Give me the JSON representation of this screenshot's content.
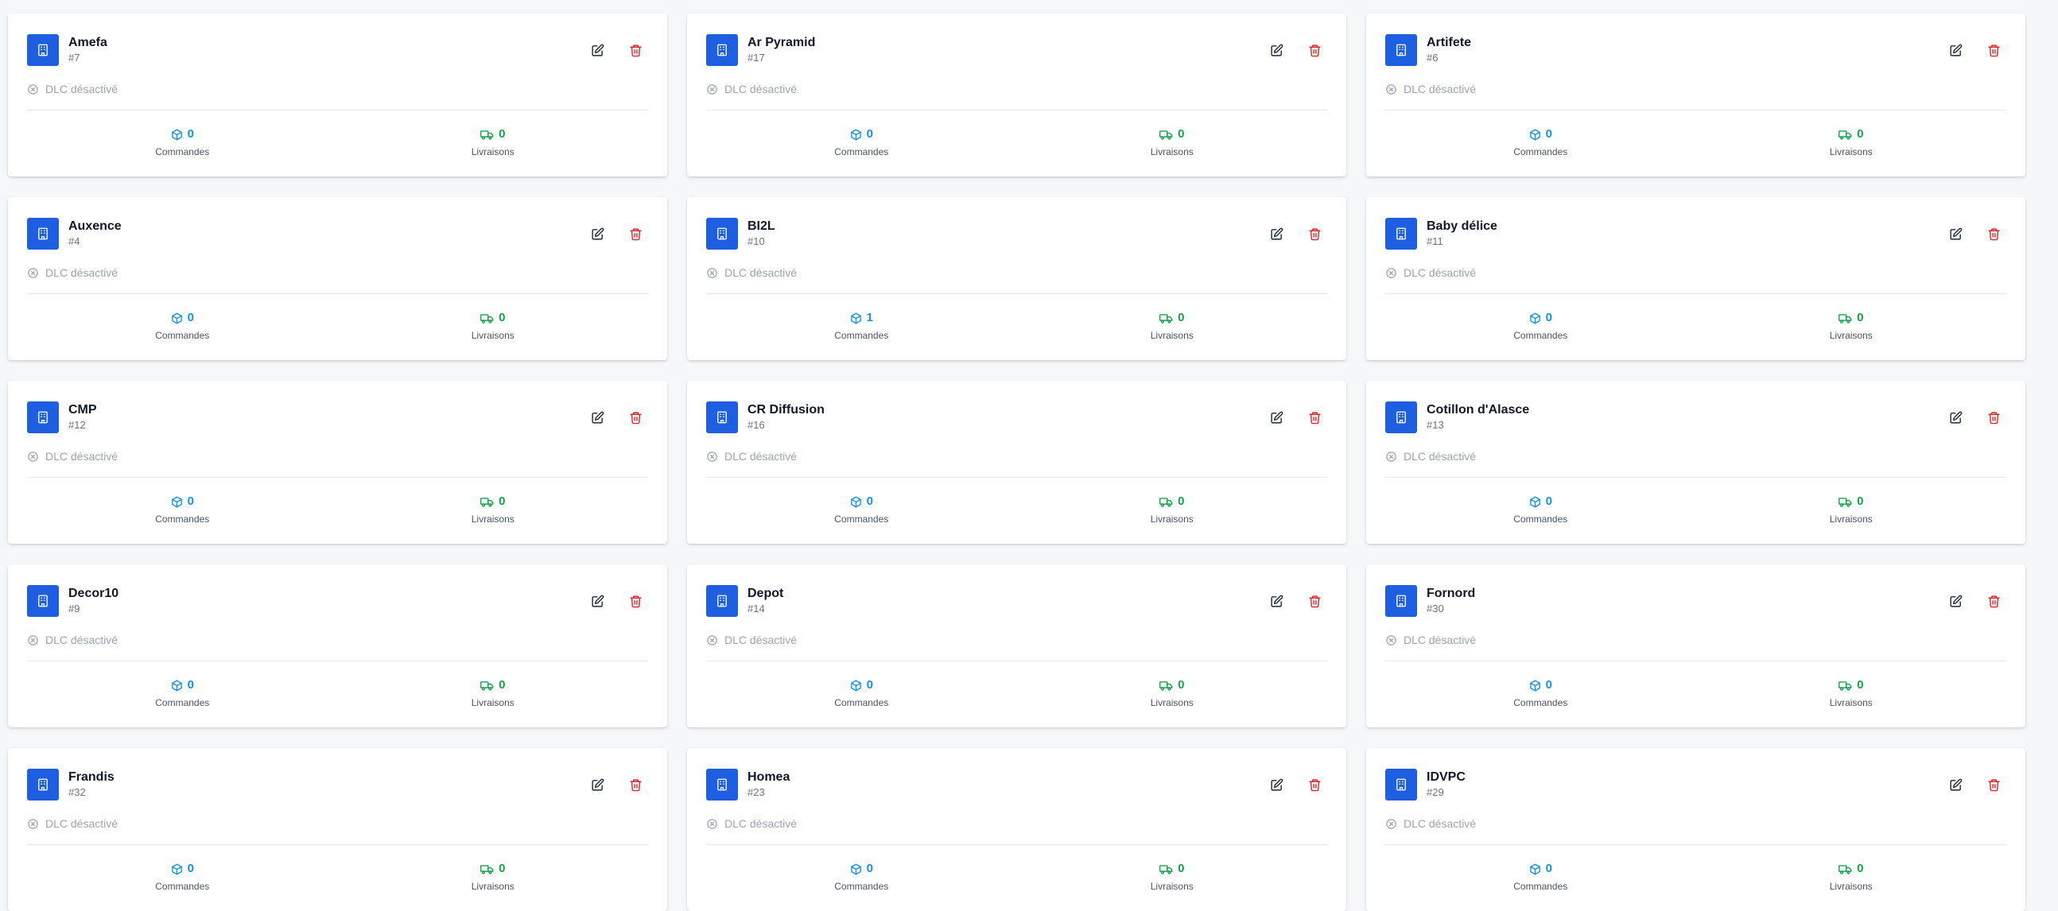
{
  "labels": {
    "dlc": "DLC désactivé",
    "orders": "Commandes",
    "deliveries": "Livraisons"
  },
  "colors": {
    "badge": "#1d5fe0",
    "orders": "#1492e6",
    "deliveries": "#15a34a",
    "delete": "#dc2626"
  },
  "icons": {
    "badge": "building-icon",
    "edit": "edit-icon",
    "delete": "trash-icon",
    "dlc": "circle-x-icon",
    "orders": "box-icon",
    "deliveries": "truck-icon"
  },
  "clients": [
    {
      "name": "Amefa",
      "id": "#7",
      "orders": "0",
      "deliveries": "0"
    },
    {
      "name": "Ar Pyramid",
      "id": "#17",
      "orders": "0",
      "deliveries": "0"
    },
    {
      "name": "Artifete",
      "id": "#6",
      "orders": "0",
      "deliveries": "0"
    },
    {
      "name": "Auxence",
      "id": "#4",
      "orders": "0",
      "deliveries": "0"
    },
    {
      "name": "BI2L",
      "id": "#10",
      "orders": "1",
      "deliveries": "0"
    },
    {
      "name": "Baby délice",
      "id": "#11",
      "orders": "0",
      "deliveries": "0"
    },
    {
      "name": "CMP",
      "id": "#12",
      "orders": "0",
      "deliveries": "0"
    },
    {
      "name": "CR Diffusion",
      "id": "#16",
      "orders": "0",
      "deliveries": "0"
    },
    {
      "name": "Cotillon d'Alasce",
      "id": "#13",
      "orders": "0",
      "deliveries": "0"
    },
    {
      "name": "Decor10",
      "id": "#9",
      "orders": "0",
      "deliveries": "0"
    },
    {
      "name": "Depot",
      "id": "#14",
      "orders": "0",
      "deliveries": "0"
    },
    {
      "name": "Fornord",
      "id": "#30",
      "orders": "0",
      "deliveries": "0"
    },
    {
      "name": "Frandis",
      "id": "#32",
      "orders": "0",
      "deliveries": "0"
    },
    {
      "name": "Homea",
      "id": "#23",
      "orders": "0",
      "deliveries": "0"
    },
    {
      "name": "IDVPC",
      "id": "#29",
      "orders": "0",
      "deliveries": "0"
    }
  ]
}
